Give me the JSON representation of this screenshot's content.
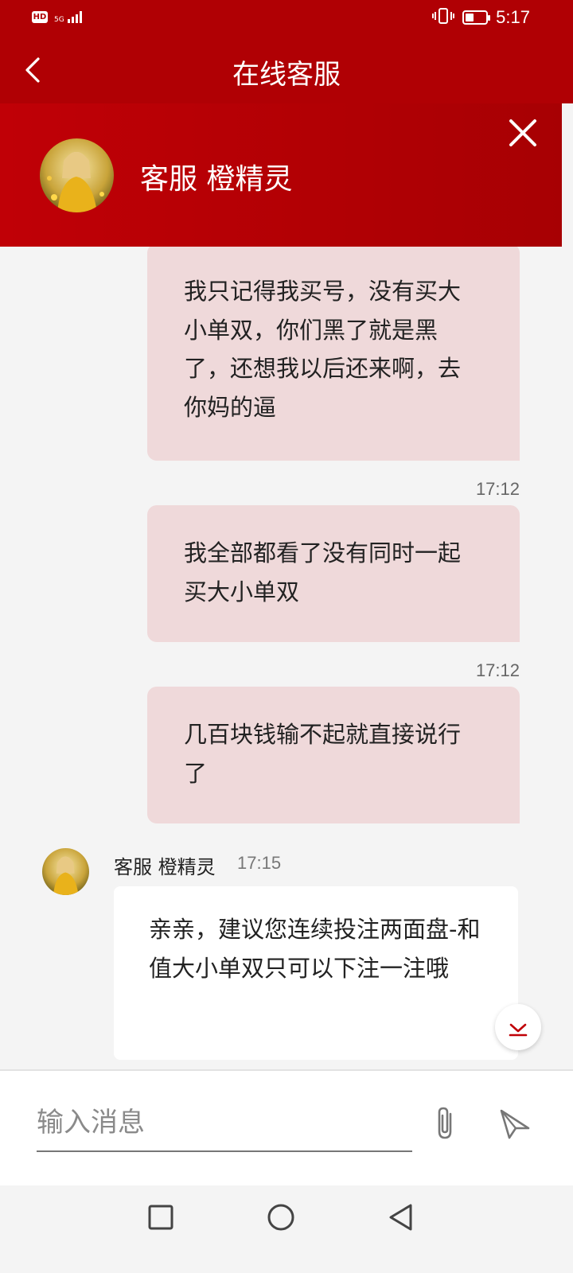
{
  "status_bar": {
    "hd_badge": "HD",
    "network": "5G",
    "time": "5:17",
    "battery_level": 0.4
  },
  "header": {
    "title": "在线客服",
    "agent_name": "客服 橙精灵"
  },
  "messages": [
    {
      "type": "outgoing",
      "text": "我只记得我买号，没有买大小单双，你们黑了就是黑了，还想我以后还来啊，去你妈的逼",
      "time": "17:12"
    },
    {
      "type": "outgoing",
      "text": "我全部都看了没有同时一起买大小单双",
      "time": "17:12"
    },
    {
      "type": "outgoing",
      "text": "几百块钱输不起就直接说行了"
    },
    {
      "type": "incoming",
      "sender": "客服 橙精灵",
      "time": "17:15",
      "text": "亲亲，建议您连续投注两面盘-和值大小单双只可以下注一注哦"
    }
  ],
  "input": {
    "placeholder": "输入消息"
  },
  "colors": {
    "brand_red": "#b00004",
    "outgoing_bubble": "#efd9da",
    "incoming_bubble": "#ffffff"
  },
  "icons": [
    "back-icon",
    "close-icon",
    "paperclip-icon",
    "send-icon",
    "chevron-down-icon",
    "vibrate-icon",
    "battery-icon",
    "signal-icon",
    "nav-square-icon",
    "nav-circle-icon",
    "nav-triangle-icon"
  ]
}
